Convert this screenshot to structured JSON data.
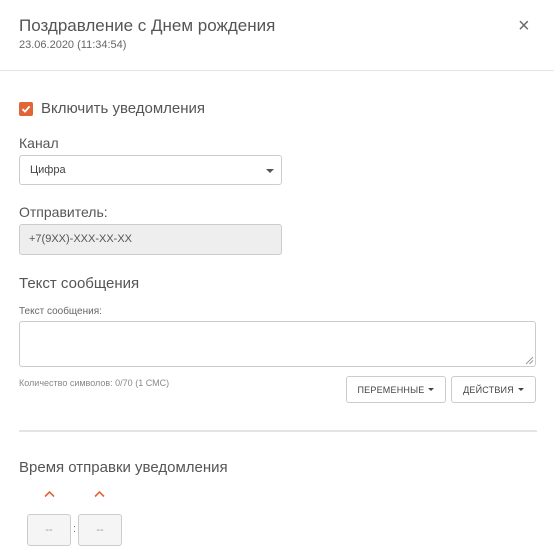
{
  "header": {
    "title": "Поздравление с Днем рождения",
    "datetime": "23.06.2020 (11:34:54)",
    "close_icon": "×"
  },
  "notifications": {
    "enable_label": "Включить уведомления",
    "enabled": true
  },
  "channel": {
    "label": "Канал",
    "selected": "Цифра"
  },
  "sender": {
    "label": "Отправитель:",
    "value": "+7(9XX)-XXX-XX-XX"
  },
  "message": {
    "section_title": "Текст сообщения",
    "field_label": "Текст сообщения:",
    "value": "",
    "counter": "Количество символов: 0/70 (1 СМС)"
  },
  "buttons": {
    "variables": "ПЕРЕМЕННЫЕ",
    "actions": "ДЕЙСТВИЯ"
  },
  "send_time": {
    "title": "Время отправки уведомления",
    "hours": "--",
    "separator": ":",
    "minutes": "--"
  },
  "colors": {
    "accent": "#e0663a",
    "border": "#cccccc",
    "disabled_bg": "#eeeeee"
  }
}
